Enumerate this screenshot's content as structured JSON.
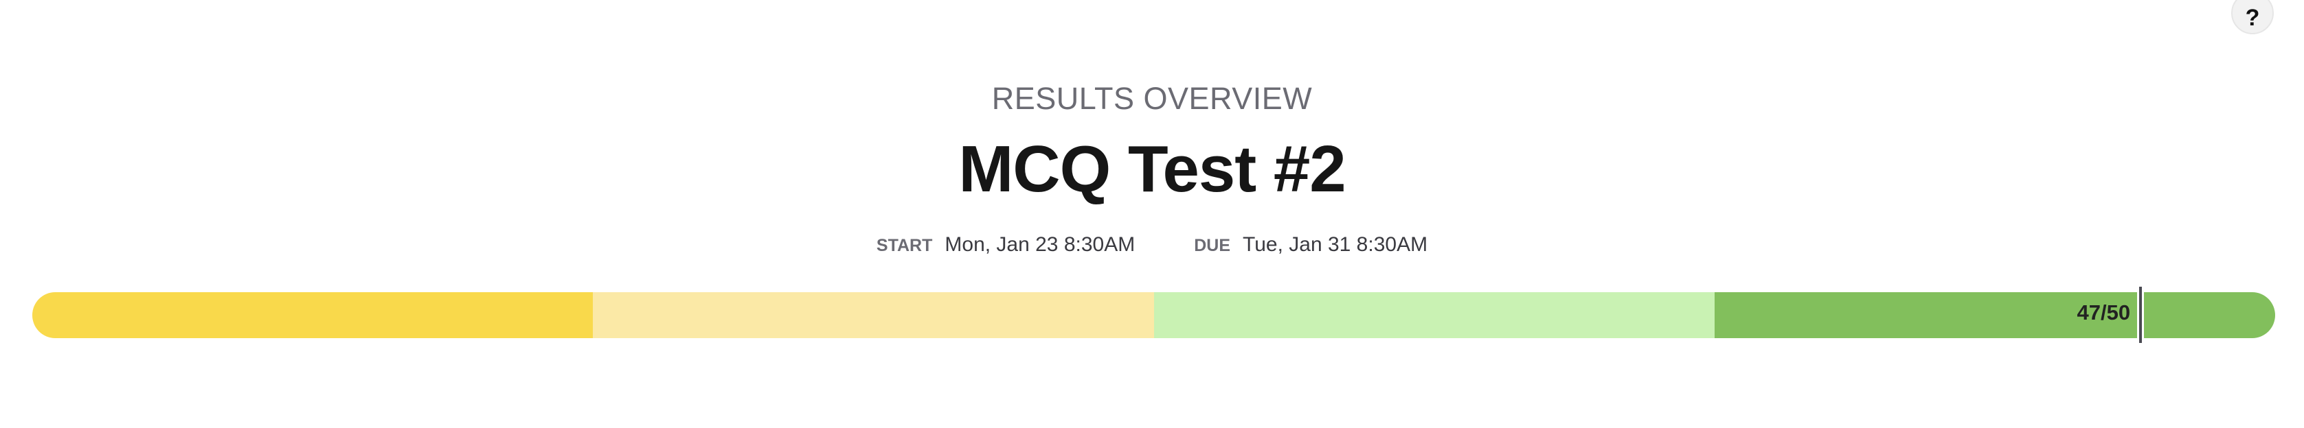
{
  "help_button": {
    "label": "?"
  },
  "header": {
    "subtitle": "RESULTS OVERVIEW",
    "title": "MCQ Test #2"
  },
  "dates": {
    "start_label": "START",
    "start_value": "Mon, Jan 23 8:30AM",
    "due_label": "DUE",
    "due_value": "Tue, Jan 31 8:30AM"
  },
  "score_bar": {
    "score_label": "47/50",
    "score": 47,
    "max": 50,
    "segment_colors": [
      "#f9d94b",
      "#fbe9a6",
      "#c9f2b3",
      "#82bf5c"
    ],
    "marker_color": "#4a4a52"
  }
}
